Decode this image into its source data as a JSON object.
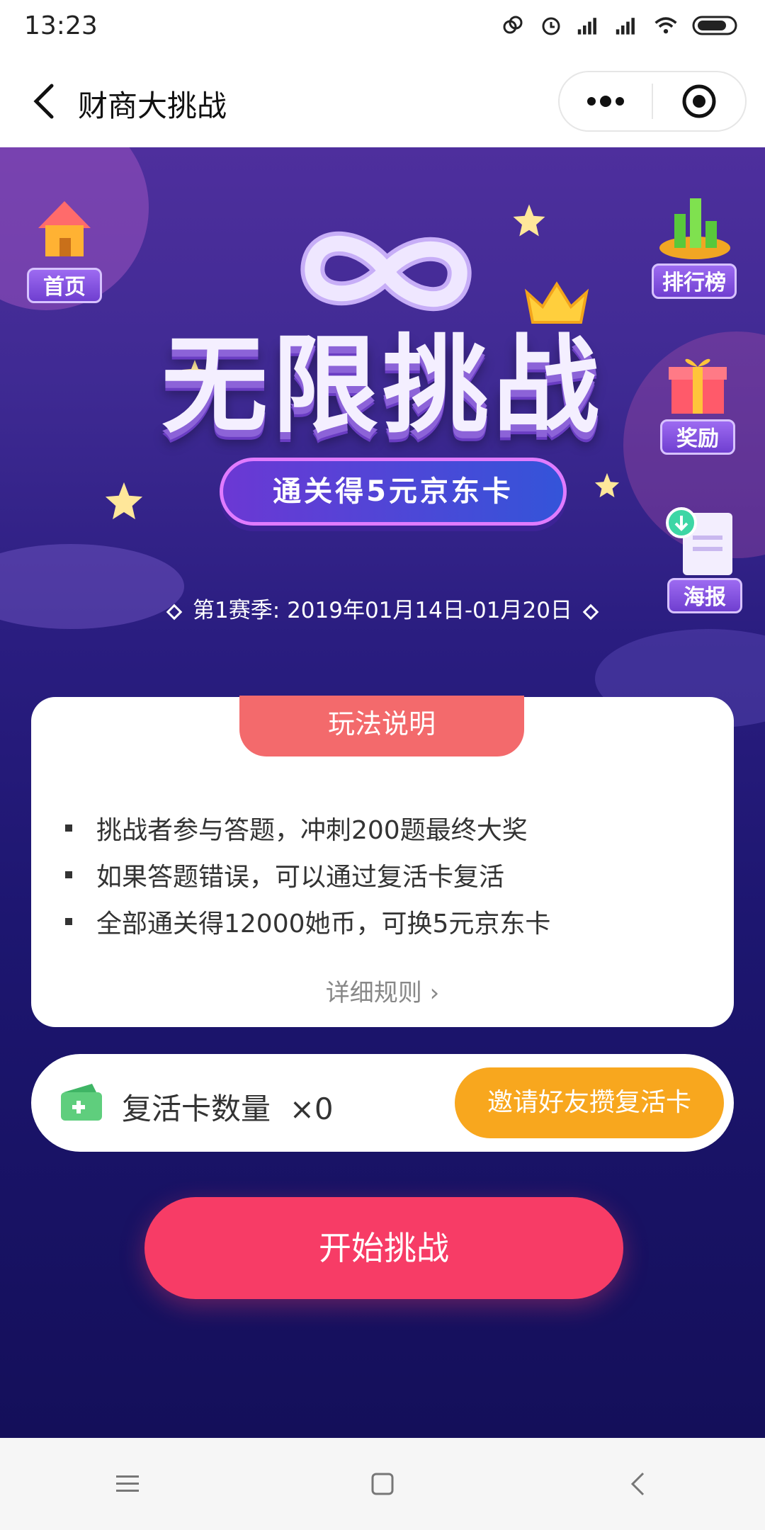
{
  "status": {
    "time": "13:23",
    "icons": [
      "link-icon",
      "alarm-icon",
      "signal-icon",
      "signal-icon",
      "wifi-icon",
      "battery-icon"
    ]
  },
  "nav": {
    "title": "财商大挑战",
    "back_icon": "back-arrow-icon",
    "more_icon": "more-dots-icon",
    "close_icon": "target-icon"
  },
  "hero": {
    "side_buttons": {
      "home": "首页",
      "ranking": "排行榜",
      "rewards": "奖励",
      "poster": "海报"
    },
    "title": "无限挑战",
    "prize": "通关得5元京东卡",
    "season": "第1赛季: 2019年01月14日-01月20日"
  },
  "rules": {
    "tab": "玩法说明",
    "items": [
      "挑战者参与答题，冲刺200题最终大奖",
      "如果答题错误，可以通过复活卡复活",
      "全部通关得12000她币，可换5元京东卡"
    ],
    "detail_link": "详细规则 ›"
  },
  "revive": {
    "label": "复活卡数量",
    "count": "×0",
    "invite_button": "邀请好友攒复活卡"
  },
  "start_button": "开始挑战",
  "colors": {
    "rules_tab": "#f36a6c",
    "invite_button": "#f8a71e",
    "start_button": "#f73c66",
    "hero_top": "#4e2f9d",
    "hero_bottom": "#140f5a"
  }
}
